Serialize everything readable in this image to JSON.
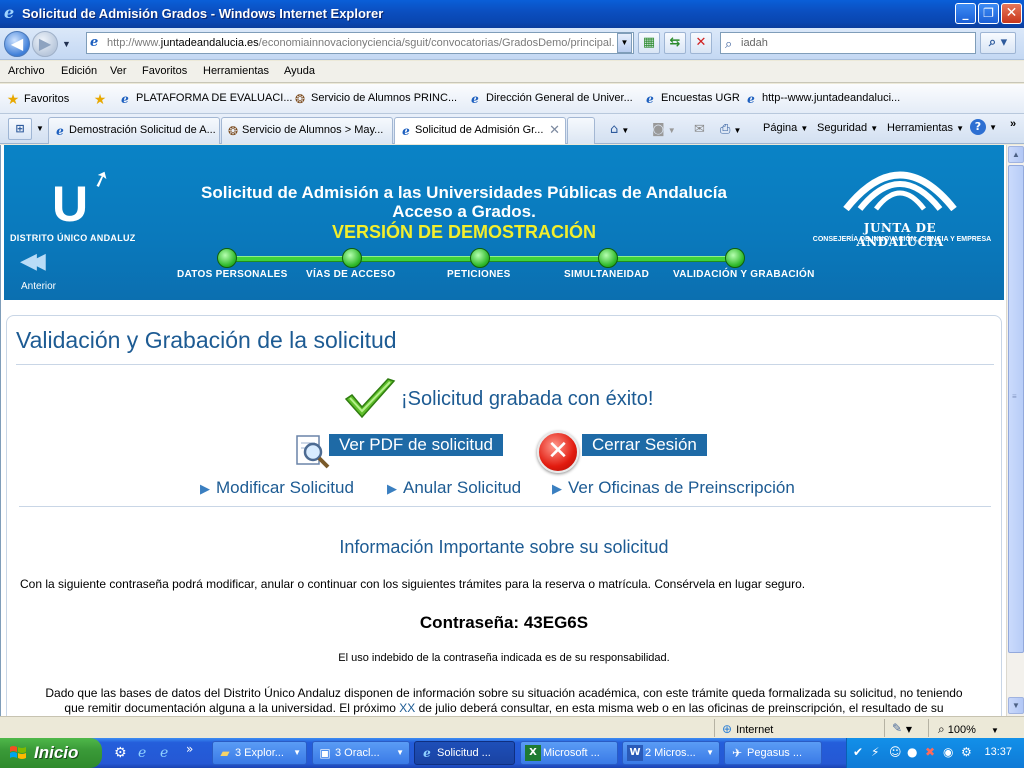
{
  "window": {
    "title": "Solicitud de Admisión Grados - Windows Internet Explorer"
  },
  "address": {
    "url_prefix": "http://www.",
    "url_domain": "juntadeandalucia.es",
    "url_path": "/economiainnovacionyciencia/sguit/convocatorias/GradosDemo/principal.",
    "search_text": "iadah"
  },
  "menu": [
    "Archivo",
    "Edición",
    "Ver",
    "Favoritos",
    "Herramientas",
    "Ayuda"
  ],
  "favorites": {
    "label": "Favoritos",
    "items": [
      {
        "label": "PLATAFORMA DE EVALUACI...",
        "icon": "ie-page-icon"
      },
      {
        "label": "Servicio de Alumnos PRINC...",
        "icon": "university-seal-icon"
      },
      {
        "label": "Dirección General de Univer...",
        "icon": "ie-page-icon"
      },
      {
        "label": "Encuestas UGR",
        "icon": "ie-page-icon"
      },
      {
        "label": "http--www.juntadeandaluci...",
        "icon": "ie-page-icon"
      }
    ]
  },
  "tabs": [
    {
      "label": "Demostración Solicitud de A...",
      "icon": "ie-page-icon"
    },
    {
      "label": "Servicio de Alumnos > May...",
      "icon": "university-seal-icon"
    },
    {
      "label": "Solicitud de Admisión Gr...",
      "icon": "ie-page-icon",
      "active": true
    }
  ],
  "commands": {
    "page": "Página",
    "security": "Seguridad",
    "tools": "Herramientas"
  },
  "banner": {
    "logo_text": "DISTRITO ÚNICO ANDALUZ",
    "prev_label": "Anterior",
    "title_line1": "Solicitud de Admisión a las Universidades Públicas de Andalucía",
    "title_line2": "Acceso a Grados.",
    "demo": "VERSIÓN DE DEMOSTRACIÓN",
    "steps": [
      "DATOS PERSONALES",
      "VÍAS DE ACCESO",
      "PETICIONES",
      "SIMULTANEIDAD",
      "VALIDACIÓN Y GRABACIÓN"
    ],
    "junta_name": "JUNTA DE ANDALUCIA",
    "junta_sub": "CONSEJERÍA DE INNOVACIÓN, CIENCIA Y EMPRESA"
  },
  "main": {
    "heading": "Validación y Grabación de la solicitud",
    "success": "¡Solicitud grabada con éxito!",
    "pdf_button": "Ver PDF de solicitud",
    "close_button": "Cerrar Sesión",
    "links": [
      "Modificar Solicitud",
      "Anular Solicitud",
      "Ver Oficinas de Preinscripción"
    ],
    "info_heading": "Información Importante sobre su solicitud",
    "info_text": "Con la siguiente contraseña podrá modificar, anular o continuar con los siguientes trámites para la reserva o matrícula. Consérvela en lugar seguro.",
    "password_line": "Contraseña: 43EG6S",
    "password_warning": "El uso indebido de la contraseña indicada es de su responsabilidad.",
    "para_line1": "Dado que las bases de datos del Distrito Único Andaluz disponen de información sobre su situación académica, con este trámite queda formalizada su solicitud, no teniendo",
    "para_line2_a": "que remitir documentación alguna a la universidad. El próximo ",
    "para_line2_xx": "XX",
    "para_line2_b": " de julio deberá consultar, en esta misma web o en las oficinas de preinscripción, el resultado de su"
  },
  "status": {
    "zone": "Internet",
    "zoom": "100%"
  },
  "taskbar": {
    "start": "Inicio",
    "tasks": [
      {
        "label": "3 Explor...",
        "icon": "folder-icon"
      },
      {
        "label": "3 Oracl...",
        "icon": "oracle-icon"
      },
      {
        "label": "Solicitud ...",
        "icon": "ie-page-icon",
        "active": true
      },
      {
        "label": "Microsoft ...",
        "icon": "excel-icon"
      },
      {
        "label": "2 Micros...",
        "icon": "word-icon"
      },
      {
        "label": "Pegasus ...",
        "icon": "pegasus-icon"
      }
    ],
    "clock": "13:37"
  }
}
